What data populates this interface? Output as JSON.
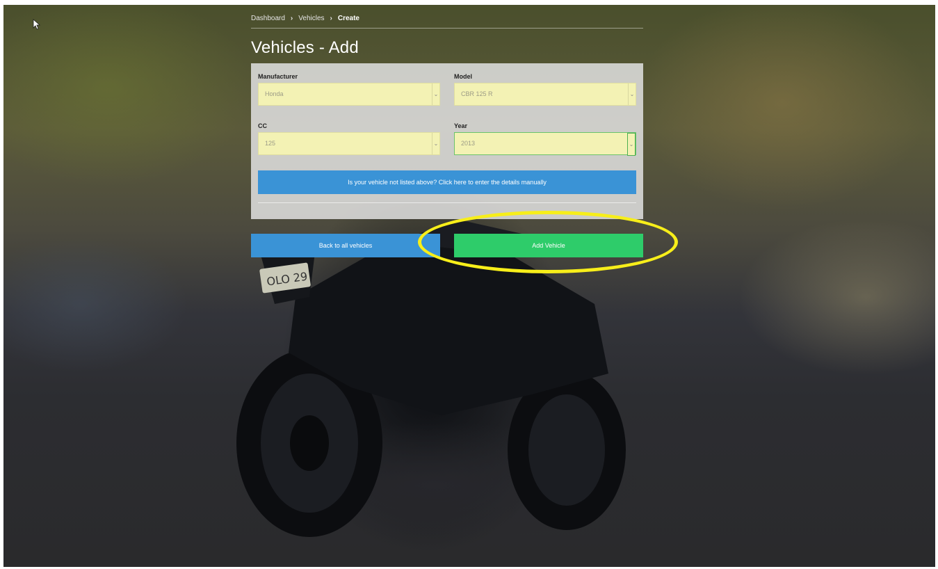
{
  "breadcrumb": {
    "items": [
      "Dashboard",
      "Vehicles"
    ],
    "separator": "›",
    "current": "Create"
  },
  "page": {
    "title": "Vehicles - Add"
  },
  "form": {
    "manufacturer": {
      "label": "Manufacturer",
      "value": "Honda"
    },
    "model": {
      "label": "Model",
      "value": "CBR 125 R"
    },
    "cc": {
      "label": "CC",
      "value": "125"
    },
    "year": {
      "label": "Year",
      "value": "2013"
    },
    "manual_entry_label": "Is your vehicle not listed above? Click here to enter the details manually"
  },
  "actions": {
    "back_label": "Back to all vehicles",
    "add_label": "Add Vehicle"
  },
  "icons": {
    "select_chevron": "chevron-down-icon",
    "cursor": "mouse-pointer-icon"
  },
  "colors": {
    "primary_blue": "#3a93d6",
    "success_green": "#2ecc6a",
    "select_fill": "#f3f2b4",
    "annotation_yellow": "#f7ee1a"
  }
}
